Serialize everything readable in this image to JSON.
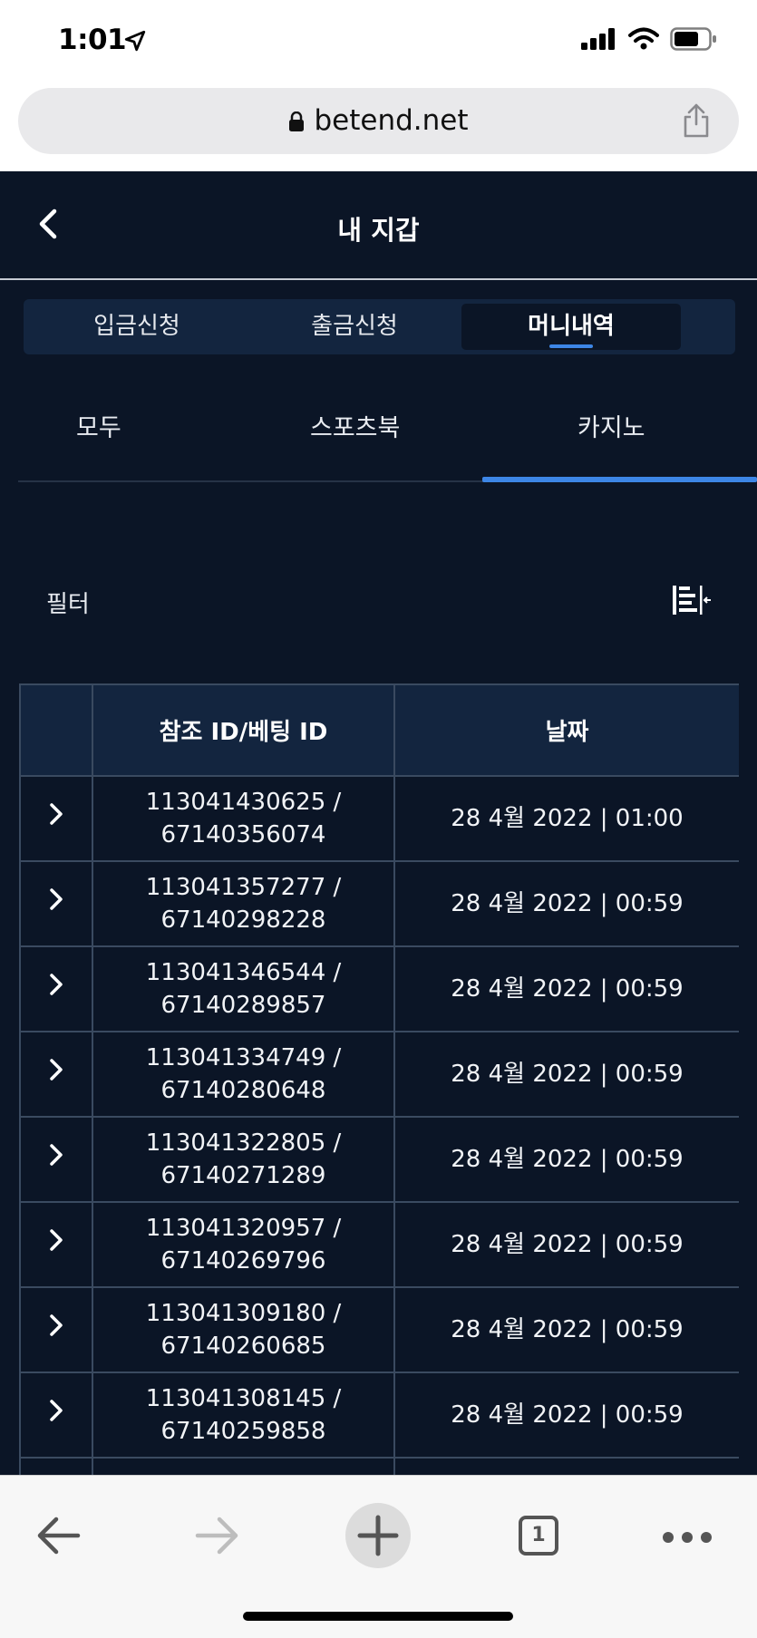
{
  "status_bar": {
    "time": "1:01"
  },
  "browser": {
    "url": "betend.net",
    "tab_count": "1"
  },
  "header": {
    "title": "내 지갑"
  },
  "top_tabs": [
    {
      "label": "입금신청",
      "active": false
    },
    {
      "label": "출금신청",
      "active": false
    },
    {
      "label": "머니내역",
      "active": true
    }
  ],
  "sub_tabs": [
    {
      "label": "모두",
      "active": false
    },
    {
      "label": "스포츠북",
      "active": false
    },
    {
      "label": "카지노",
      "active": true
    }
  ],
  "filter": {
    "label": "필터"
  },
  "table": {
    "columns": [
      "",
      "참조 ID/베팅 ID",
      "날짜"
    ],
    "rows": [
      {
        "ref_id": "113041430625 /",
        "bet_id": "67140356074",
        "date": "28 4월 2022 | 01:00"
      },
      {
        "ref_id": "113041357277 /",
        "bet_id": "67140298228",
        "date": "28 4월 2022 | 00:59"
      },
      {
        "ref_id": "113041346544 /",
        "bet_id": "67140289857",
        "date": "28 4월 2022 | 00:59"
      },
      {
        "ref_id": "113041334749 /",
        "bet_id": "67140280648",
        "date": "28 4월 2022 | 00:59"
      },
      {
        "ref_id": "113041322805 /",
        "bet_id": "67140271289",
        "date": "28 4월 2022 | 00:59"
      },
      {
        "ref_id": "113041320957 /",
        "bet_id": "67140269796",
        "date": "28 4월 2022 | 00:59"
      },
      {
        "ref_id": "113041309180 /",
        "bet_id": "67140260685",
        "date": "28 4월 2022 | 00:59"
      },
      {
        "ref_id": "113041308145 /",
        "bet_id": "67140259858",
        "date": "28 4월 2022 | 00:59"
      }
    ]
  },
  "colors": {
    "background": "#0b1526",
    "panel": "#13253f",
    "accent": "#3d86e6",
    "border": "#3a4a60"
  }
}
